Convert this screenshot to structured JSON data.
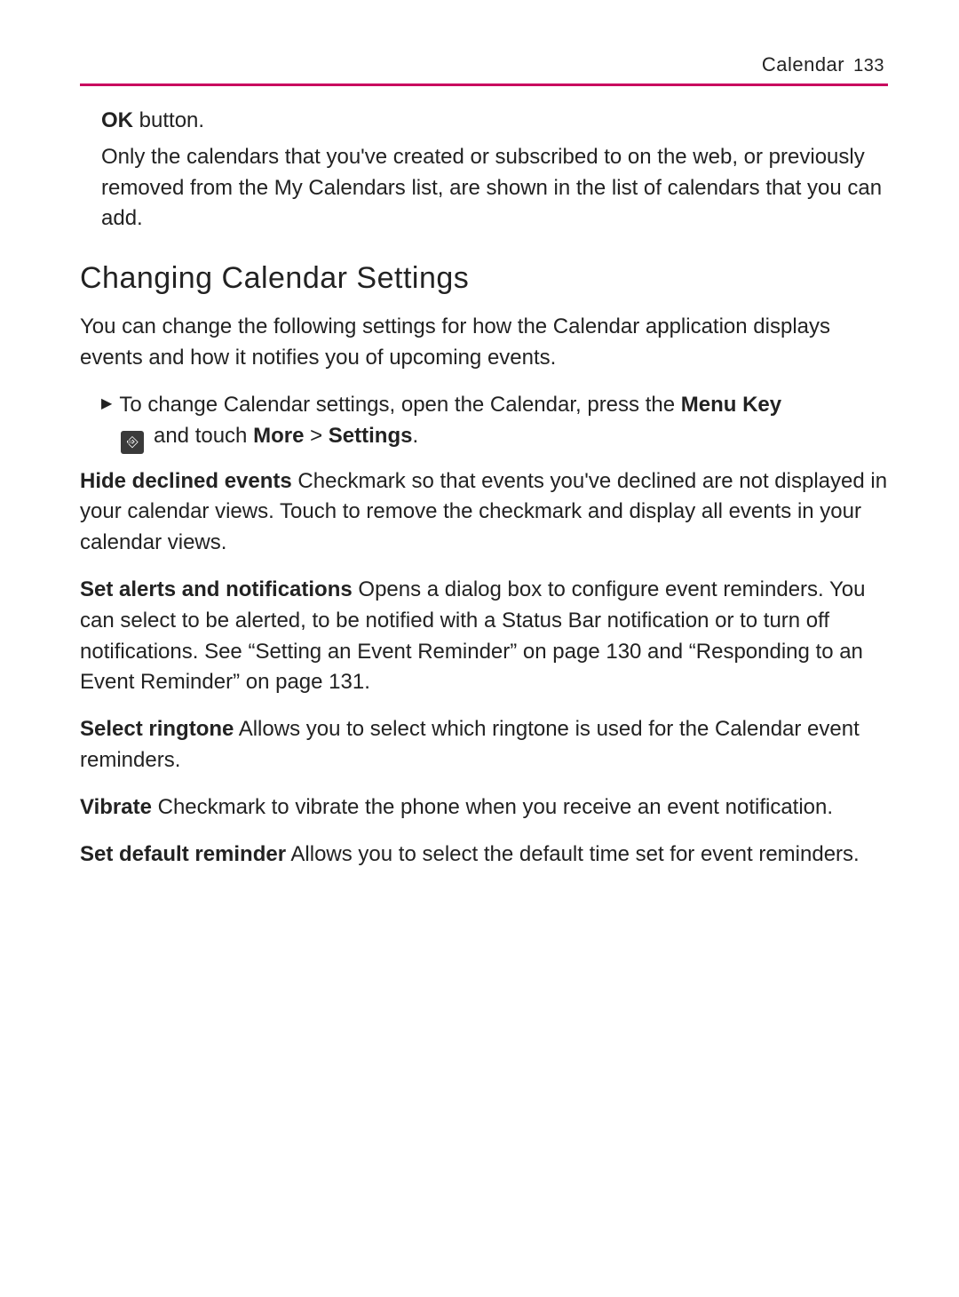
{
  "header": {
    "section": "Calendar",
    "page_number": "133"
  },
  "intro": {
    "ok_bold": "OK",
    "ok_rest": " button.",
    "ok_followup": "Only the calendars that you've created or subscribed to on the web, or previously removed from the My Calendars list, are shown in the list of calendars that you can add."
  },
  "heading": "Changing Calendar Settings",
  "lead": "You can change the following settings for how the Calendar application displays events and how it notifies you of upcoming events.",
  "bullet": {
    "line1_pre": "To change Calendar settings, open the Calendar, press the ",
    "line1_bold": "Menu Key",
    "line2_pre": " and touch ",
    "line2_bold1": "More",
    "line2_gt": " > ",
    "line2_bold2": "Settings",
    "line2_post": "."
  },
  "settings": {
    "hide_label": "Hide declined events",
    "hide_text": " Checkmark so that events you've declined are not displayed in your calendar views. Touch to remove the checkmark and display all events in your calendar views.",
    "alerts_label": "Set alerts and notifications",
    "alerts_text": " Opens a dialog box to configure event reminders. You can select to be alerted, to be notified with a Status Bar notification or to turn off notifications. See “Setting an Event Reminder” on page 130 and “Responding to an Event Reminder” on page 131.",
    "ringtone_label": "Select ringtone",
    "ringtone_text": " Allows you to select which ringtone is used for the Calendar event reminders.",
    "vibrate_label": "Vibrate",
    "vibrate_text": " Checkmark to vibrate the phone when you receive an event notification.",
    "default_label": "Set default reminder",
    "default_text": " Allows you to select the default time set for event reminders."
  },
  "icons": {
    "bullet_arrow": "▶",
    "menu_key_glyph": "⎆"
  }
}
